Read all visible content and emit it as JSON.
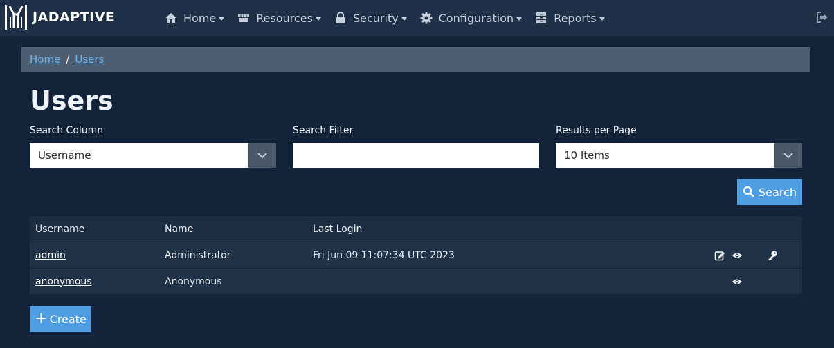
{
  "brand": {
    "name": "JADAPTIVE"
  },
  "nav": {
    "items": [
      {
        "label": "Home",
        "icon": "home-icon"
      },
      {
        "label": "Resources",
        "icon": "store-icon"
      },
      {
        "label": "Security",
        "icon": "lock-icon"
      },
      {
        "label": "Configuration",
        "icon": "gear-icon"
      },
      {
        "label": "Reports",
        "icon": "archive-icon"
      }
    ],
    "logout_icon": "sign-out-icon"
  },
  "breadcrumb": {
    "home": "Home",
    "current": "Users"
  },
  "page": {
    "title": "Users"
  },
  "filters": {
    "search_column": {
      "label": "Search Column",
      "value": "Username"
    },
    "search_filter": {
      "label": "Search Filter",
      "value": "",
      "placeholder": ""
    },
    "results_per_page": {
      "label": "Results per Page",
      "value": "10 Items"
    }
  },
  "buttons": {
    "search": "Search",
    "create": "Create"
  },
  "table": {
    "columns": [
      "Username",
      "Name",
      "Last Login"
    ],
    "rows": [
      {
        "username": "admin",
        "name": "Administrator",
        "last_login": "Fri Jun 09 11:07:34 UTC 2023",
        "actions": [
          "edit-icon",
          "view-icon",
          "key-icon"
        ]
      },
      {
        "username": "anonymous",
        "name": "Anonymous",
        "last_login": "",
        "actions": [
          "view-icon"
        ]
      }
    ]
  },
  "colors": {
    "background": "#12233a",
    "navbar": "#1e3148",
    "accent": "#4f9de2",
    "breadcrumb": "#4d5e70"
  }
}
